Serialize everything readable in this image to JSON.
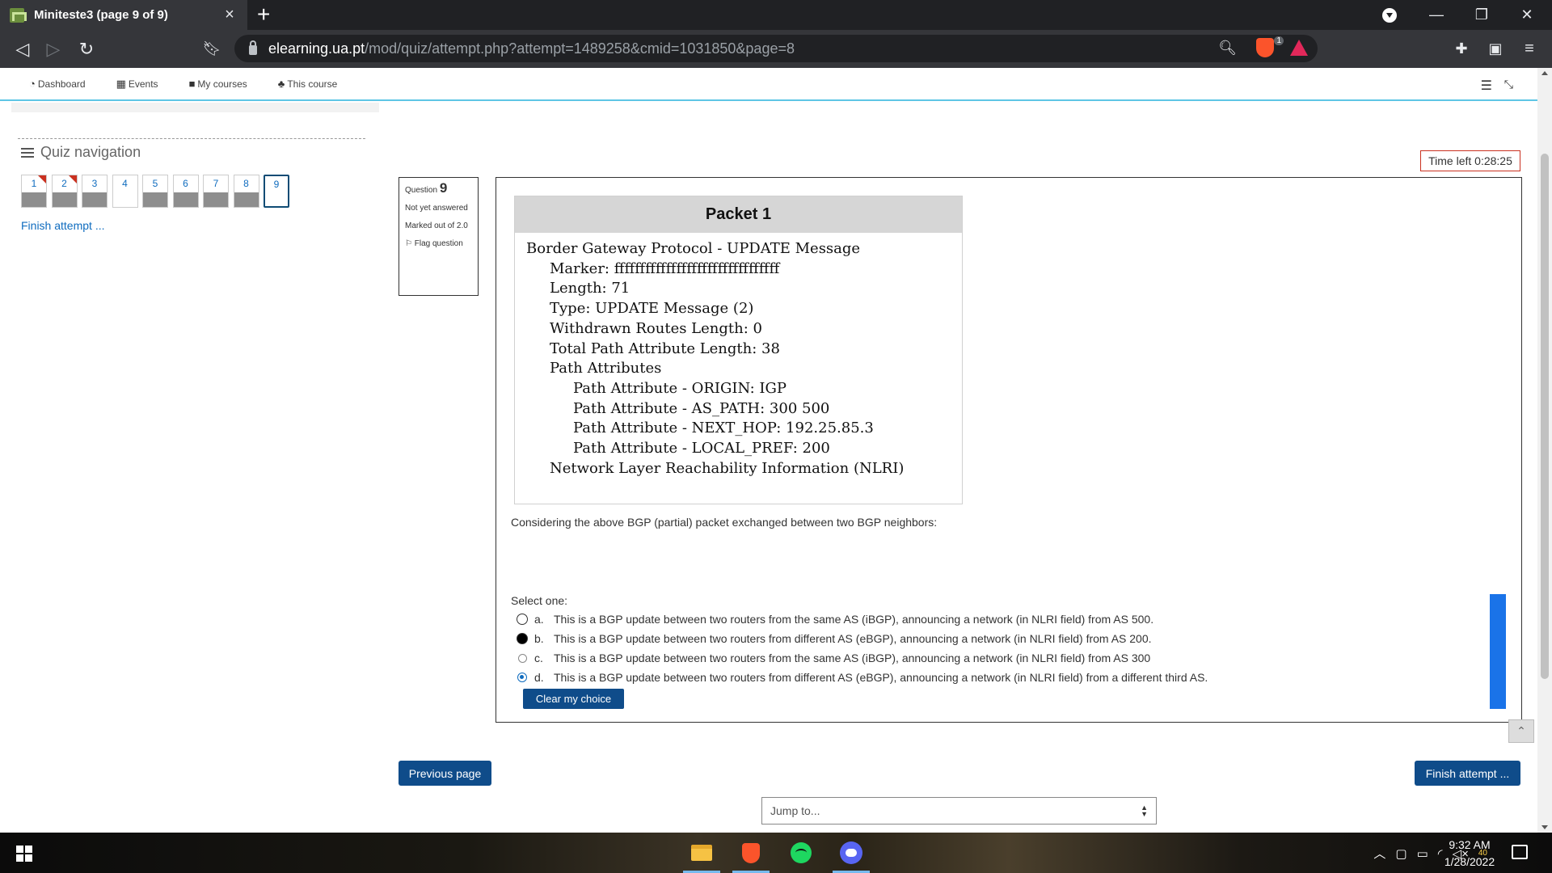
{
  "browser": {
    "tab_title": "Miniteste3 (page 9 of 9)",
    "url_host": "elearning.ua.pt",
    "url_path": "/mod/quiz/attempt.php?attempt=1489258&cmid=1031850&page=8",
    "shield_count": "1"
  },
  "moodle_nav": {
    "items": [
      {
        "label": "Dashboard",
        "icon": "dashboard-icon"
      },
      {
        "label": "Events",
        "icon": "calendar-icon"
      },
      {
        "label": "My courses",
        "icon": "briefcase-icon"
      },
      {
        "label": "This course",
        "icon": "sitemap-icon"
      }
    ]
  },
  "quiz_nav": {
    "title": "Quiz navigation",
    "buttons": [
      {
        "label": "1",
        "state": "answered",
        "flagged": true
      },
      {
        "label": "2",
        "state": "answered",
        "flagged": true
      },
      {
        "label": "3",
        "state": "answered",
        "flagged": false
      },
      {
        "label": "4",
        "state": "not-answered",
        "flagged": false
      },
      {
        "label": "5",
        "state": "answered",
        "flagged": false
      },
      {
        "label": "6",
        "state": "answered",
        "flagged": false
      },
      {
        "label": "7",
        "state": "answered",
        "flagged": false
      },
      {
        "label": "8",
        "state": "answered",
        "flagged": false
      },
      {
        "label": "9",
        "state": "current",
        "flagged": false
      }
    ],
    "finish_link": "Finish attempt ..."
  },
  "question_info": {
    "label": "Question",
    "number": "9",
    "status": "Not yet answered",
    "marks": "Marked out of 2.0",
    "flag": "Flag question"
  },
  "timer": "Time left 0:28:25",
  "packet": {
    "title": "Packet 1",
    "lines": [
      {
        "indent": 0,
        "text": "Border Gateway Protocol - UPDATE Message"
      },
      {
        "indent": 1,
        "text": "Marker: ffffffffffffffffffffffffffffffff"
      },
      {
        "indent": 1,
        "text": "Length: 71"
      },
      {
        "indent": 1,
        "text": "Type: UPDATE Message (2)"
      },
      {
        "indent": 1,
        "text": "Withdrawn Routes Length: 0"
      },
      {
        "indent": 1,
        "text": "Total Path Attribute Length: 38"
      },
      {
        "indent": 1,
        "text": "Path Attributes"
      },
      {
        "indent": 2,
        "text": "Path Attribute - ORIGIN: IGP"
      },
      {
        "indent": 2,
        "text": "Path Attribute - AS_PATH: 300 500"
      },
      {
        "indent": 2,
        "text": "Path Attribute - NEXT_HOP: 192.25.85.3"
      },
      {
        "indent": 2,
        "text": "Path Attribute - LOCAL_PREF: 200"
      },
      {
        "indent": 1,
        "text": "Network Layer Reachability Information (NLRI)"
      }
    ]
  },
  "question_text": "Considering the above BGP (partial) packet exchanged between two BGP neighbors:",
  "select_one": "Select one:",
  "options": [
    {
      "letter": "a.",
      "text": "This is a BGP update between two routers from the same AS (iBGP), announcing a network (in NLRI field) from AS 500.",
      "radio": "outline"
    },
    {
      "letter": "b.",
      "text": "This is a BGP update between two routers from different AS (eBGP), announcing a network (in NLRI field) from AS 200.",
      "radio": "filled"
    },
    {
      "letter": "c.",
      "text": "This is a BGP update between two routers from the same AS (iBGP), announcing a network (in NLRI field) from AS 300",
      "radio": "light"
    },
    {
      "letter": "d.",
      "text": "This is a BGP update between two routers from different AS (eBGP), announcing a network (in NLRI field) from a different third AS.",
      "radio": "selected"
    }
  ],
  "selected_option": "d.",
  "clear_choice": "Clear my choice",
  "previous_page": "Previous page",
  "finish_attempt": "Finish attempt ...",
  "jump_to": "Jump to...",
  "taskbar": {
    "time": "9:32 AM",
    "date": "1/28/2022",
    "tray_badge": "40",
    "apps": [
      "file-explorer-icon",
      "brave-icon",
      "spotify-icon",
      "discord-icon"
    ]
  }
}
